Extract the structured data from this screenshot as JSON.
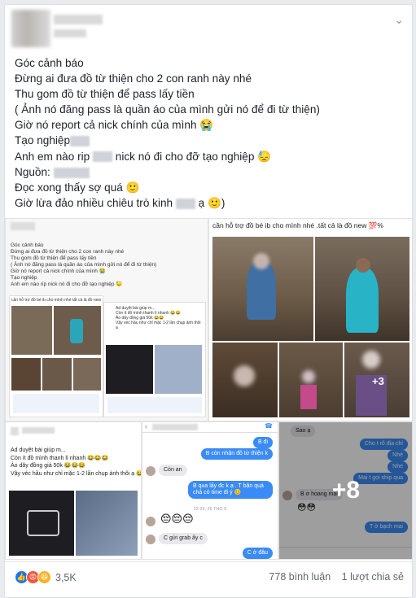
{
  "post": {
    "lines": [
      "Góc cảnh báo",
      "Đừng ai đưa đồ từ thiện cho 2 con ranh này nhé",
      "Thu gom đồ từ thiện để pass lấy tiền",
      "( Ảnh nó đăng pass là quần áo của mình gửi nó để đi từ thiện)",
      "Giờ nó report cả nick chính của mình 😭",
      "Tạo nghiệp",
      "Anh em nào rip",
      "nick nó đi cho đỡ tạo nghiệp 😓",
      "Nguồn:",
      "Đọc xong thấy sợ quá 🙂",
      "Giờ lừa đảo nhiều chiêu trò kinh",
      "ạ 🙂)"
    ]
  },
  "media": {
    "shot1_lines": [
      "Góc cảnh báo",
      "Đừng ai đưa đồ từ thiện cho 2 con ranh này nhé",
      "Thu gom đồ từ thiện để pass lấy tiền",
      "( Ảnh nó đăng pass là quần áo của mình gửi nó để đi từ thiện)",
      "Giờ nó report cả nick chính của mình 😭",
      "Tạo nghiệp",
      "Anh em nào rip    nick nó đi cho đỡ tạo nghiệp 😓"
    ],
    "shot1_sub": "cần hỗ trợ đồ bé ib cho mình nhé tất cả là đồ new",
    "shot1_inner": [
      "Ad duyệt bài giúp m...",
      "Còn ít đồ mình thanh lí nhanh 😂😂",
      "Áo dây đồng giá 50k 😂😂",
      "Vậy véc hầu như chỉ mặc 1-2 lần chụp ảnh thôi ạ"
    ],
    "photo_caption": "cần hỗ trợ đồ bé ib cho mình nhé .tất cả là đồ new 💯%",
    "plus3": "+3",
    "sale_lines": [
      "Ad duyệt bài giúp m...",
      "Còn ít đồ mình thanh lí nhanh 😂😂😂",
      "Áo dây đồng giá 50k 😂😂😂",
      "Vậy véc hầu như chỉ mặc 1-2 lần chụp ảnh thôi ạ 😂"
    ],
    "chat_mid": [
      "B đi",
      "B còn nhận đồ từ thiện k",
      "Còn an",
      "B qua lấy đc k ạ . T bận quá chả có time đi ý 😊",
      "C gửi grab ấy c",
      "C ở đâu"
    ],
    "chat_mid_emoji": "😔😔😔",
    "chat_mid_time": "22:23, 25 THG 5",
    "chat_right": [
      "Sao ạ",
      "Cho t rõ địa chỉ",
      "Nhé",
      "Nhe",
      "Mai t gọi ship qua",
      "B ơ hoang mai",
      "T ở bạch mai"
    ],
    "chat_right_emoji": "😳😳",
    "plus8": "+8"
  },
  "footer": {
    "reaction_count": "3,5K",
    "comments": "778 bình luận",
    "shares": "1 lượt chia sẻ"
  }
}
